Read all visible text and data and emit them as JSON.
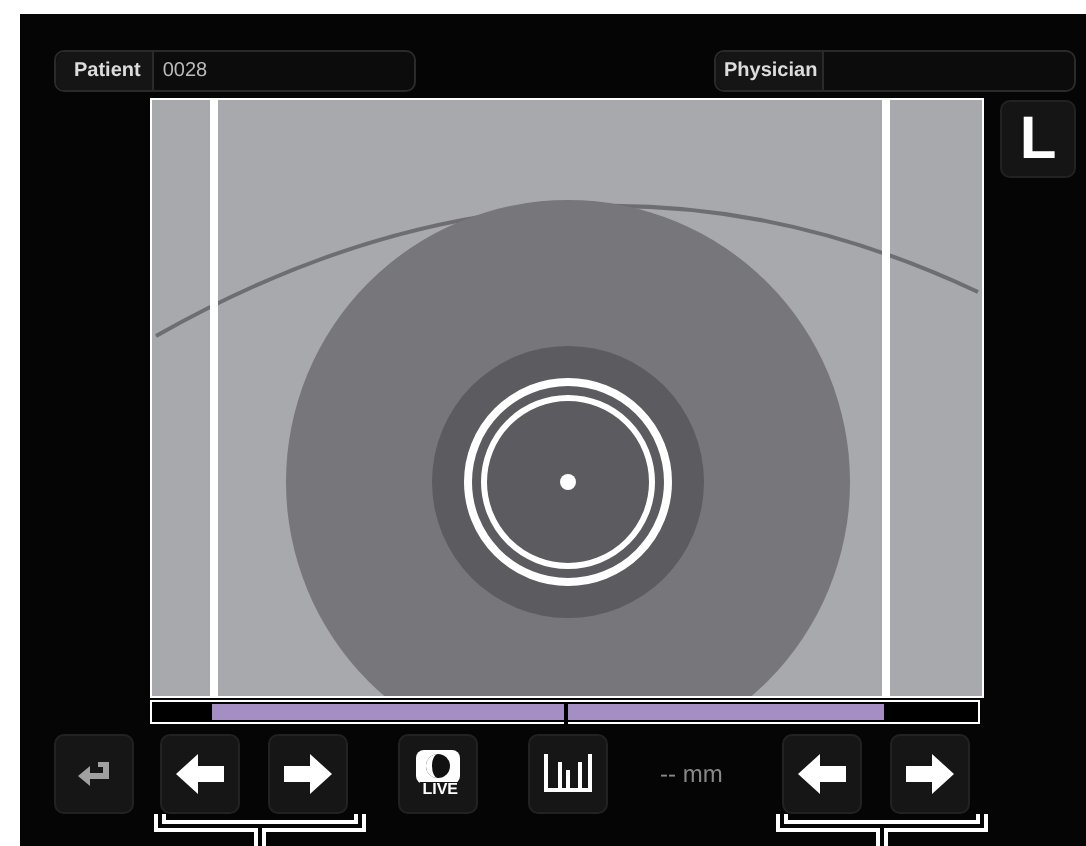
{
  "patient": {
    "label": "Patient",
    "value": "0028"
  },
  "physician": {
    "label": "Physician"
  },
  "eye": "L",
  "live_label": "LIVE",
  "measurement": "-- mm"
}
